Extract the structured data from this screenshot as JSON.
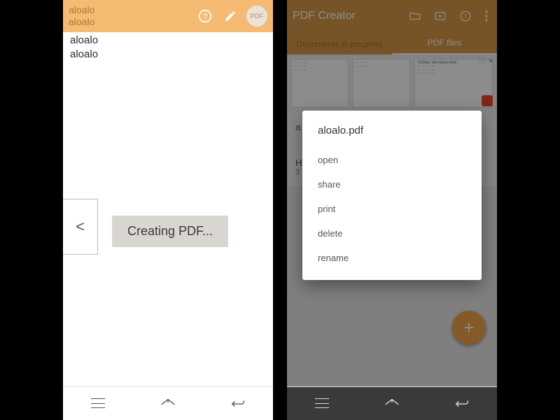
{
  "left": {
    "topbar": {
      "line1": "aloalo",
      "line2": "aloalo",
      "pdf_badge": "PDF"
    },
    "lines": [
      "aloalo",
      "aloalo"
    ],
    "back_arrow": "<",
    "creating_label": "Creating PDF..."
  },
  "right": {
    "topbar": {
      "title": "PDF Creator"
    },
    "tabs": {
      "inactive": "Documents in progress",
      "active": "PDF files"
    },
    "preview_header": "THÔNG TIN HÀNG HÓA",
    "files": [
      {
        "t1": "a",
        "t2": ""
      },
      {
        "t1": "H",
        "t2": "3"
      }
    ],
    "popup": {
      "title": "aloalo.pdf",
      "items": [
        "open",
        "share",
        "print",
        "delete",
        "rename"
      ]
    },
    "fab_label": "+"
  }
}
